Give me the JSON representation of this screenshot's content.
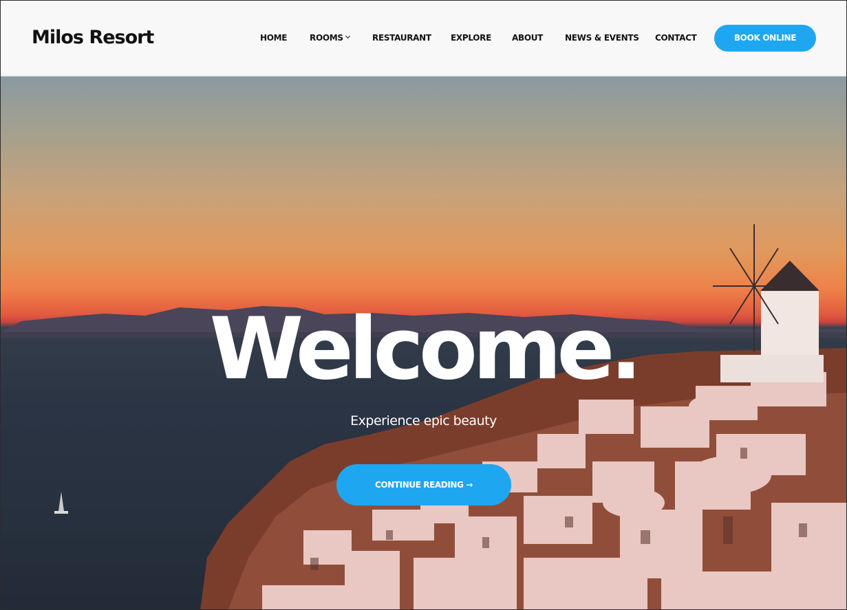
{
  "site": {
    "logo": "Milos Resort"
  },
  "nav": {
    "items": [
      {
        "label": "HOME"
      },
      {
        "label": "ROOMS",
        "has_dropdown": true
      },
      {
        "label": "RESTAURANT"
      },
      {
        "label": "EXPLORE"
      },
      {
        "label": "ABOUT"
      },
      {
        "label": "NEWS & EVENTS"
      },
      {
        "label": "CONTACT"
      }
    ],
    "book_button": "BOOK ONLINE"
  },
  "hero": {
    "title": "Welcome.",
    "subtitle": "Experience epic beauty",
    "cta_label": "CONTINUE READING →",
    "background_image": "sunset-over-sea-cliff-village"
  },
  "colors": {
    "accent": "#1ea7f0",
    "header_bg": "#f8f8f8",
    "text_dark": "#111111"
  },
  "icons": {
    "rooms_dropdown": "chevron-down-icon"
  }
}
